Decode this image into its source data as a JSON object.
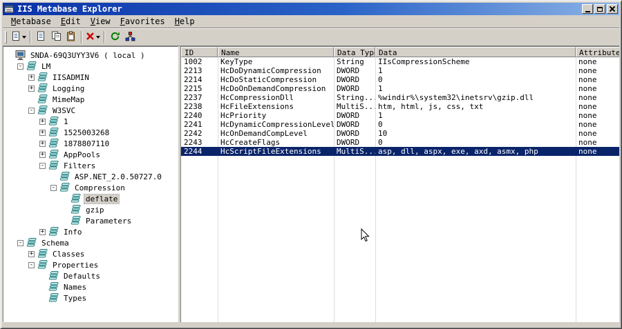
{
  "window": {
    "title": "IIS Metabase Explorer",
    "caption_icons": [
      "app-icon",
      "minimize-icon",
      "maximize-icon",
      "close-icon"
    ]
  },
  "menu": {
    "items": [
      "Metabase",
      "Edit",
      "View",
      "Favorites",
      "Help"
    ]
  },
  "toolbar": {
    "buttons": [
      {
        "name": "new-key-button",
        "icon": "db-icon",
        "dropdown": true
      },
      {
        "sep": true
      },
      {
        "name": "new-value-button",
        "icon": "page-icon",
        "dropdown": false
      },
      {
        "name": "copy-button",
        "icon": "copy-icon",
        "dropdown": false
      },
      {
        "name": "paste-button",
        "icon": "paste-icon",
        "dropdown": false
      },
      {
        "sep": true
      },
      {
        "name": "delete-button",
        "icon": "delete-icon",
        "dropdown": true
      },
      {
        "sep": true
      },
      {
        "name": "refresh-button",
        "icon": "refresh-icon",
        "dropdown": false
      },
      {
        "name": "connect-button",
        "icon": "connect-icon",
        "dropdown": false
      }
    ]
  },
  "tree": {
    "nodes": [
      {
        "label": "SNDA-69Q3UYY3V6 ( local )",
        "depth": 0,
        "toggle": "none",
        "icon": "computer"
      },
      {
        "label": "LM",
        "depth": 1,
        "toggle": "minus",
        "icon": "db"
      },
      {
        "label": "IISADMIN",
        "depth": 2,
        "toggle": "plus",
        "icon": "db"
      },
      {
        "label": "Logging",
        "depth": 2,
        "toggle": "plus",
        "icon": "db"
      },
      {
        "label": "MimeMap",
        "depth": 2,
        "toggle": "none",
        "icon": "db"
      },
      {
        "label": "W3SVC",
        "depth": 2,
        "toggle": "minus",
        "icon": "db"
      },
      {
        "label": "1",
        "depth": 3,
        "toggle": "plus",
        "icon": "db"
      },
      {
        "label": "1525003268",
        "depth": 3,
        "toggle": "plus",
        "icon": "db"
      },
      {
        "label": "1878807110",
        "depth": 3,
        "toggle": "plus",
        "icon": "db"
      },
      {
        "label": "AppPools",
        "depth": 3,
        "toggle": "plus",
        "icon": "db"
      },
      {
        "label": "Filters",
        "depth": 3,
        "toggle": "minus",
        "icon": "db"
      },
      {
        "label": "ASP.NET_2.0.50727.0",
        "depth": 4,
        "toggle": "none",
        "icon": "db"
      },
      {
        "label": "Compression",
        "depth": 4,
        "toggle": "minus",
        "icon": "db"
      },
      {
        "label": "deflate",
        "depth": 5,
        "toggle": "none",
        "icon": "db",
        "selected": true
      },
      {
        "label": "gzip",
        "depth": 5,
        "toggle": "none",
        "icon": "db"
      },
      {
        "label": "Parameters",
        "depth": 5,
        "toggle": "none",
        "icon": "db"
      },
      {
        "label": "Info",
        "depth": 3,
        "toggle": "plus",
        "icon": "db"
      },
      {
        "label": "Schema",
        "depth": 1,
        "toggle": "minus",
        "icon": "db"
      },
      {
        "label": "Classes",
        "depth": 2,
        "toggle": "plus",
        "icon": "db"
      },
      {
        "label": "Properties",
        "depth": 2,
        "toggle": "minus",
        "icon": "db"
      },
      {
        "label": "Defaults",
        "depth": 3,
        "toggle": "none",
        "icon": "db"
      },
      {
        "label": "Names",
        "depth": 3,
        "toggle": "none",
        "icon": "db"
      },
      {
        "label": "Types",
        "depth": 3,
        "toggle": "none",
        "icon": "db"
      }
    ]
  },
  "list": {
    "columns": [
      "ID",
      "Name",
      "Data Type",
      "Data",
      "Attributes"
    ],
    "selected_index": 10,
    "rows": [
      [
        "1002",
        "KeyType",
        "String",
        "IIsCompressionScheme",
        "none"
      ],
      [
        "2213",
        "HcDoDynamicCompression",
        "DWORD",
        "1",
        "none"
      ],
      [
        "2214",
        "HcDoStaticCompression",
        "DWORD",
        "0",
        "none"
      ],
      [
        "2215",
        "HcDoOnDemandCompression",
        "DWORD",
        "1",
        "none"
      ],
      [
        "2237",
        "HcCompressionDll",
        "String...",
        "%windir%\\system32\\inetsrv\\gzip.dll",
        "none"
      ],
      [
        "2238",
        "HcFileExtensions",
        "MultiS...",
        "htm, html, js, css, txt",
        "none"
      ],
      [
        "2240",
        "HcPriority",
        "DWORD",
        "1",
        "none"
      ],
      [
        "2241",
        "HcDynamicCompressionLevel",
        "DWORD",
        "0",
        "none"
      ],
      [
        "2242",
        "HcOnDemandCompLevel",
        "DWORD",
        "10",
        "none"
      ],
      [
        "2243",
        "HcCreateFlags",
        "DWORD",
        "0",
        "none"
      ],
      [
        "2244",
        "HcScriptFileExtensions",
        "MultiS...",
        "asp, dll, aspx, exe, axd, asmx, php",
        "none"
      ]
    ]
  },
  "colors": {
    "selection": "#0a246a",
    "titlebar_left": "#0a32a8",
    "titlebar_right": "#8cb3e6",
    "chrome": "#d4d0c8"
  }
}
